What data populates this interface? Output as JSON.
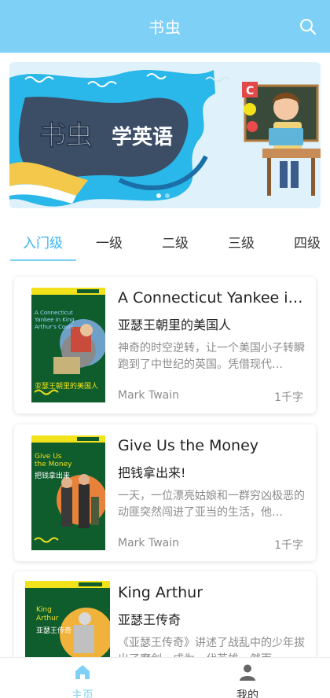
{
  "header": {
    "title": "书虫"
  },
  "banner": {
    "text": "书虫学英语"
  },
  "tabs": [
    {
      "label": "入门级",
      "active": true
    },
    {
      "label": "一级"
    },
    {
      "label": "二级"
    },
    {
      "label": "三级"
    },
    {
      "label": "四级"
    }
  ],
  "books": [
    {
      "title": "A Connecticut Yankee i…",
      "cn_title": "亚瑟王朝里的美国人",
      "desc": "神奇的时空逆转，让一个美国小子转瞬跑到了中世纪的英国。凭借现代…",
      "author": "Mark Twain",
      "words": "1千字",
      "cover_title": "A Connecticut Yankee in King Arthur's Court",
      "cover_cn": "亚瑟王朝里的美国人"
    },
    {
      "title": "Give Us the Money",
      "cn_title": "把钱拿出来!",
      "desc": "一天，一位漂亮姑娘和一群穷凶极恶的动匪突然闯进了亚当的生活，他…",
      "author": "Mark Twain",
      "words": "1千字",
      "cover_title": "Give Us the Money",
      "cover_cn": "把钱拿出来"
    },
    {
      "title": "King Arthur",
      "cn_title": "亚瑟王传奇",
      "desc": "《亚瑟王传奇》讲述了战乱中的少年拔出了魔剑，成为一代英雄。然而…",
      "author": "",
      "words": "",
      "cover_title": "King Arthur",
      "cover_cn": "亚瑟王传奇"
    }
  ],
  "nav": [
    {
      "label": "主页",
      "icon": "home-icon",
      "active": true
    },
    {
      "label": "我的",
      "icon": "user-icon",
      "active": false
    }
  ],
  "colors": {
    "accent": "#7fd0f7",
    "active_text": "#36b4ef",
    "cover_green": "#0f5c2c",
    "cover_yellow": "#f2e21b"
  }
}
